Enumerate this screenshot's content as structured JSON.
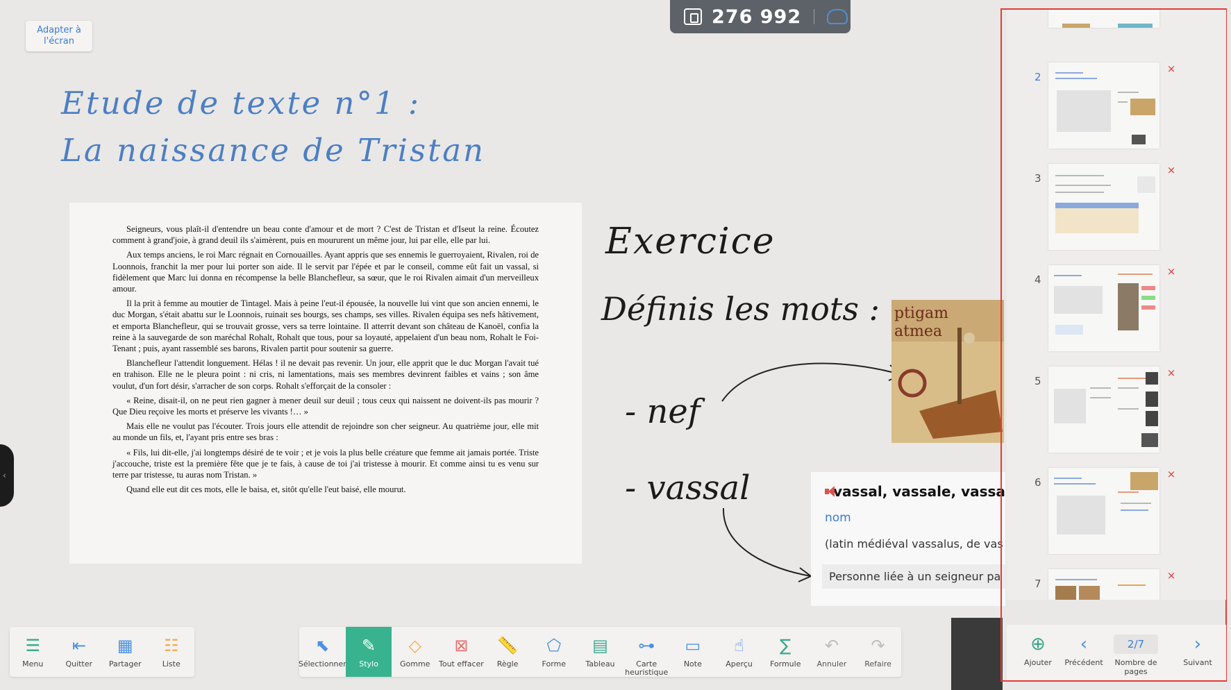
{
  "fit_button": "Adapter à l'écran",
  "counter": {
    "value": "276 992"
  },
  "title": {
    "line1": "Etude de texte n°1 :",
    "line2": "La naissance de Tristan"
  },
  "text": [
    "Seigneurs, vous plaît-il d'entendre un beau conte d'amour et de mort ? C'est de Tristan et d'Iseut la reine. Écoutez comment à grand'joie, à grand deuil ils s'aimèrent, puis en moururent un même jour, lui par elle, elle par lui.",
    "Aux temps anciens, le roi Marc régnait en Cornouailles. Ayant appris que ses ennemis le guerroyaient, Rivalen, roi de Loonnois, franchit la mer pour lui porter son aide. Il le servit par l'épée et par le conseil, comme eût fait un vassal, si fidèlement que Marc lui donna en récompense la belle Blanchefleur, sa sœur, que le roi Rivalen aimait d'un merveilleux amour.",
    "Il la prit à femme au moutier de Tintagel. Mais à peine l'eut-il épousée, la nouvelle lui vint que son ancien ennemi, le duc Morgan, s'était abattu sur le Loonnois, ruinait ses bourgs, ses champs, ses villes. Rivalen équipa ses nefs hâtivement, et emporta Blanchefleur, qui se trouvait grosse, vers sa terre lointaine. Il atterrit devant son château de Kanoël, confia la reine à la sauvegarde de son maréchal Rohalt, Rohalt que tous, pour sa loyauté, appelaient d'un beau nom, Rohalt le Foi-Tenant ; puis, ayant rassemblé ses barons, Rivalen partit pour soutenir sa guerre.",
    "Blanchefleur l'attendit longuement. Hélas ! il ne devait pas revenir. Un jour, elle apprit que le duc Morgan l'avait tué en trahison. Elle ne le pleura point : ni cris, ni lamentations, mais ses membres devinrent faibles et vains ; son âme voulut, d'un fort désir, s'arracher de son corps. Rohalt s'efforçait de la consoler :",
    "« Reine, disait-il, on ne peut rien gagner à mener deuil sur deuil ; tous ceux qui naissent ne doivent-ils pas mourir ? Que Dieu reçoive les morts et préserve les vivants !… »",
    "Mais elle ne voulut pas l'écouter. Trois jours elle attendit de rejoindre son cher seigneur. Au quatrième jour, elle mit au monde un fils, et, l'ayant pris entre ses bras :",
    "« Fils, lui dit-elle, j'ai longtemps désiré de te voir ; et je vois la plus belle créature que femme ait jamais portée. Triste j'accouche, triste est la première fête que je te fais, à cause de toi j'ai tristesse à mourir. Et comme ainsi tu es venu sur terre par tristesse, tu auras nom Tristan. »",
    "Quand elle eut dit ces mots, elle le baisa, et, sitôt qu'elle l'eut baisé, elle mourut."
  ],
  "exercise": {
    "title": "Exercice",
    "subtitle": "Définis les mots :",
    "word1": "- nef",
    "word2": "- vassal"
  },
  "dictionary": {
    "headword": "vassal, vassale, vassaux",
    "pos": "nom",
    "etymology": "(latin médiéval vassalus, de vas",
    "definition": "Personne liée à un seigneur pa"
  },
  "pages": [
    {
      "num": "2"
    },
    {
      "num": "3"
    },
    {
      "num": "4"
    },
    {
      "num": "5"
    },
    {
      "num": "6"
    },
    {
      "num": "7"
    }
  ],
  "pager": {
    "add": "Ajouter",
    "prev": "Précédent",
    "count": "2/7",
    "count_label": "Nombre de pages",
    "next": "Suivant"
  },
  "toolbar_left": [
    {
      "label": "Menu",
      "icon": "menu-icon"
    },
    {
      "label": "Quitter",
      "icon": "exit-icon"
    },
    {
      "label": "Partager",
      "icon": "qr-icon"
    },
    {
      "label": "Liste",
      "icon": "list-icon"
    }
  ],
  "toolbar_main": [
    {
      "label": "Sélectionner",
      "icon": "cursor-icon"
    },
    {
      "label": "Stylo",
      "icon": "pen-icon"
    },
    {
      "label": "Gomme",
      "icon": "eraser-icon"
    },
    {
      "label": "Tout effacer",
      "icon": "clear-all-icon"
    },
    {
      "label": "Règle",
      "icon": "ruler-icon"
    },
    {
      "label": "Forme",
      "icon": "shape-icon"
    },
    {
      "label": "Tableau",
      "icon": "table-icon"
    },
    {
      "label": "Carte heuristique",
      "icon": "mindmap-icon"
    },
    {
      "label": "Note",
      "icon": "note-icon"
    },
    {
      "label": "Aperçu",
      "icon": "touch-icon"
    },
    {
      "label": "Formule",
      "icon": "formula-icon"
    },
    {
      "label": "Annuler",
      "icon": "undo-icon"
    },
    {
      "label": "Refaire",
      "icon": "redo-icon"
    }
  ],
  "colors": {
    "accent": "#39b38f",
    "title_blue": "#4c7fc4",
    "highlight_red": "#e53935"
  }
}
